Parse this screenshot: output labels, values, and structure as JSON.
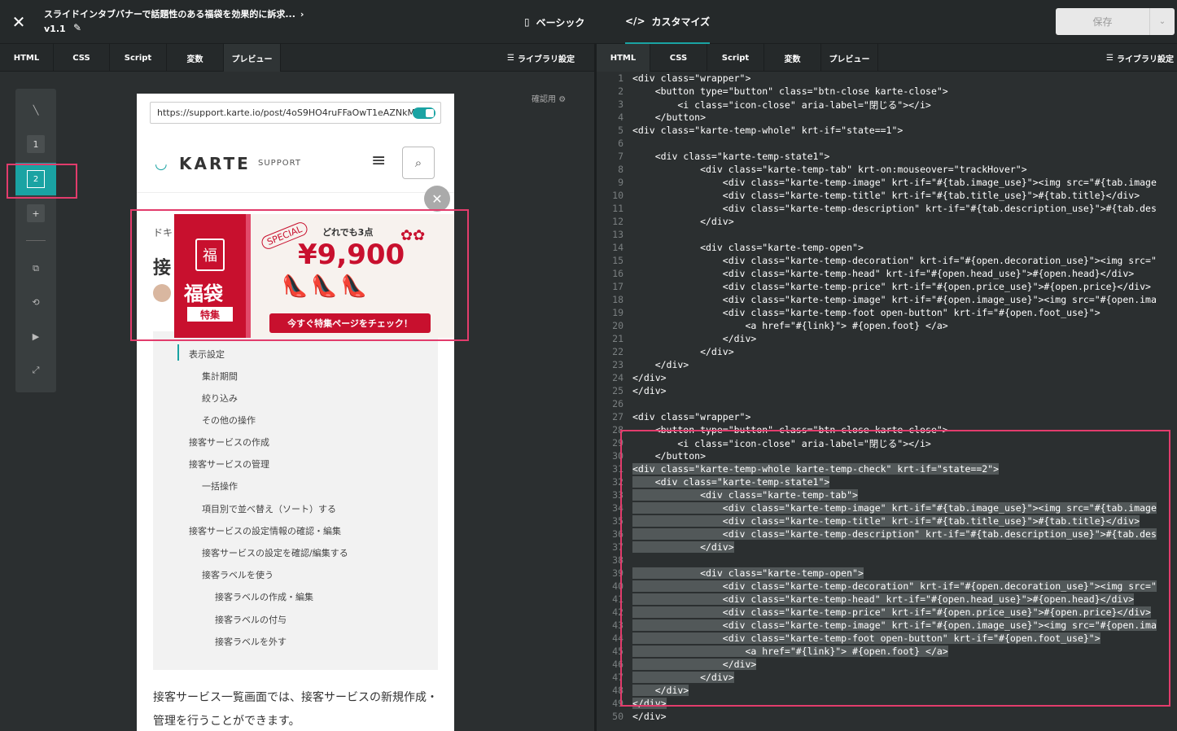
{
  "header": {
    "title": "スライドインタブバナーで話題性のある福袋を効果的に訴求...",
    "version": "v1.1",
    "mode_basic": "ベーシック",
    "mode_custom": "カスタマイズ",
    "save_label": "保存"
  },
  "left_tabs": [
    "HTML",
    "CSS",
    "Script",
    "変数",
    "プレビュー"
  ],
  "right_tabs": [
    "HTML",
    "CSS",
    "Script",
    "変数",
    "プレビュー"
  ],
  "library_settings": "ライブラリ設定",
  "toolbar": {
    "state1": "1",
    "state2": "2",
    "add": "+"
  },
  "preview": {
    "confirm_label": "確認用",
    "url": "https://support.karte.io/post/4oS9HO4ruFFaOwT1eAZNkM",
    "logo_text": "KARTE",
    "logo_sub": "SUPPORT",
    "doc_label": "ドキ",
    "big_title": "接",
    "toc": [
      "表示設定",
      "集計期間",
      "絞り込み",
      "その他の操作",
      "接客サービスの作成",
      "接客サービスの管理",
      "一括操作",
      "項目別で並べ替え（ソート）する",
      "接客サービスの設定情報の確認・編集",
      "接客サービスの設定を確認/編集する",
      "接客ラベルを使う",
      "接客ラベルの作成・編集",
      "接客ラベルの付与",
      "接客ラベルを外す"
    ],
    "body_text": "接客サービス一覧画面では、接客サービスの新規作成・管理を行うことができます。",
    "banner": {
      "bag_char": "福",
      "fukubukuro": "福袋",
      "tokushu": "特集",
      "special": "SPECIAL",
      "any_three": "どれでも3点",
      "price": "¥9,900",
      "cta": "今すぐ特集ページをチェック！"
    }
  },
  "code_lines": [
    "<div class=\"wrapper\">",
    "    <button type=\"button\" class=\"btn-close karte-close\">",
    "        <i class=\"icon-close\" aria-label=\"閉じる\"></i>",
    "    </button>",
    "<div class=\"karte-temp-whole\" krt-if=\"state==1\">",
    "",
    "    <div class=\"karte-temp-state1\">",
    "            <div class=\"karte-temp-tab\" krt-on:mouseover=\"trackHover\">",
    "                <div class=\"karte-temp-image\" krt-if=\"#{tab.image_use}\"><img src=\"#{tab.image",
    "                <div class=\"karte-temp-title\" krt-if=\"#{tab.title_use}\">#{tab.title}</div>",
    "                <div class=\"karte-temp-description\" krt-if=\"#{tab.description_use}\">#{tab.des",
    "            </div>",
    "",
    "            <div class=\"karte-temp-open\">",
    "                <div class=\"karte-temp-decoration\" krt-if=\"#{open.decoration_use}\"><img src=\"",
    "                <div class=\"karte-temp-head\" krt-if=\"#{open.head_use}\">#{open.head}</div>",
    "                <div class=\"karte-temp-price\" krt-if=\"#{open.price_use}\">#{open.price}</div>",
    "                <div class=\"karte-temp-image\" krt-if=\"#{open.image_use}\"><img src=\"#{open.ima",
    "                <div class=\"karte-temp-foot open-button\" krt-if=\"#{open.foot_use}\">",
    "                    <a href=\"#{link}\"> #{open.foot} </a>",
    "                </div>",
    "            </div>",
    "    </div>",
    "</div>",
    "</div>",
    "",
    "<div class=\"wrapper\">",
    "    <button type=\"button\" class=\"btn-close karte-close\">",
    "        <i class=\"icon-close\" aria-label=\"閉じる\"></i>",
    "    </button>",
    "<div class=\"karte-temp-whole karte-temp-check\" krt-if=\"state==2\">",
    "    <div class=\"karte-temp-state1\">",
    "            <div class=\"karte-temp-tab\">",
    "                <div class=\"karte-temp-image\" krt-if=\"#{tab.image_use}\"><img src=\"#{tab.image",
    "                <div class=\"karte-temp-title\" krt-if=\"#{tab.title_use}\">#{tab.title}</div>",
    "                <div class=\"karte-temp-description\" krt-if=\"#{tab.description_use}\">#{tab.des",
    "            </div>",
    "",
    "            <div class=\"karte-temp-open\">",
    "                <div class=\"karte-temp-decoration\" krt-if=\"#{open.decoration_use}\"><img src=\"",
    "                <div class=\"karte-temp-head\" krt-if=\"#{open.head_use}\">#{open.head}</div>",
    "                <div class=\"karte-temp-price\" krt-if=\"#{open.price_use}\">#{open.price}</div>",
    "                <div class=\"karte-temp-image\" krt-if=\"#{open.image_use}\"><img src=\"#{open.ima",
    "                <div class=\"karte-temp-foot open-button\" krt-if=\"#{open.foot_use}\">",
    "                    <a href=\"#{link}\"> #{open.foot} </a>",
    "                </div>",
    "            </div>",
    "    </div>",
    "</div>",
    "</div>"
  ]
}
